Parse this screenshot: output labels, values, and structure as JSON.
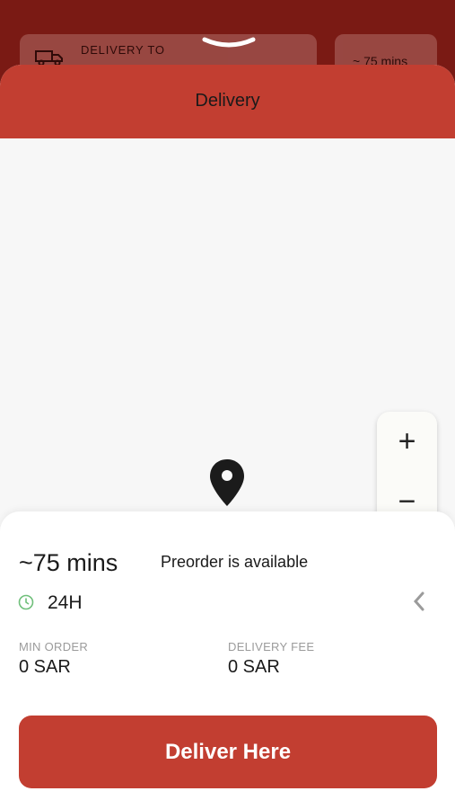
{
  "background": {
    "delivery_to_label": "DELIVERY TO",
    "eta_chip": "~ 75 mins"
  },
  "sheet": {
    "title": "Delivery"
  },
  "map": {
    "zoom_in": "+",
    "zoom_out": "−"
  },
  "info": {
    "eta": "~75 mins",
    "preorder": "Preorder is available",
    "hours": "24H",
    "min_order_label": "MIN ORDER",
    "min_order_value": "0 SAR",
    "delivery_fee_label": "DELIVERY FEE",
    "delivery_fee_value": "0 SAR",
    "cta": "Deliver Here"
  },
  "icons": {
    "truck": "truck-icon",
    "grabber": "chevron-down-icon",
    "pin": "map-pin-icon",
    "locate": "locate-icon",
    "clock": "clock-icon",
    "chevron": "chevron-left-icon"
  },
  "colors": {
    "brand": "#c23e31",
    "clock_green": "#6fbf7a"
  }
}
